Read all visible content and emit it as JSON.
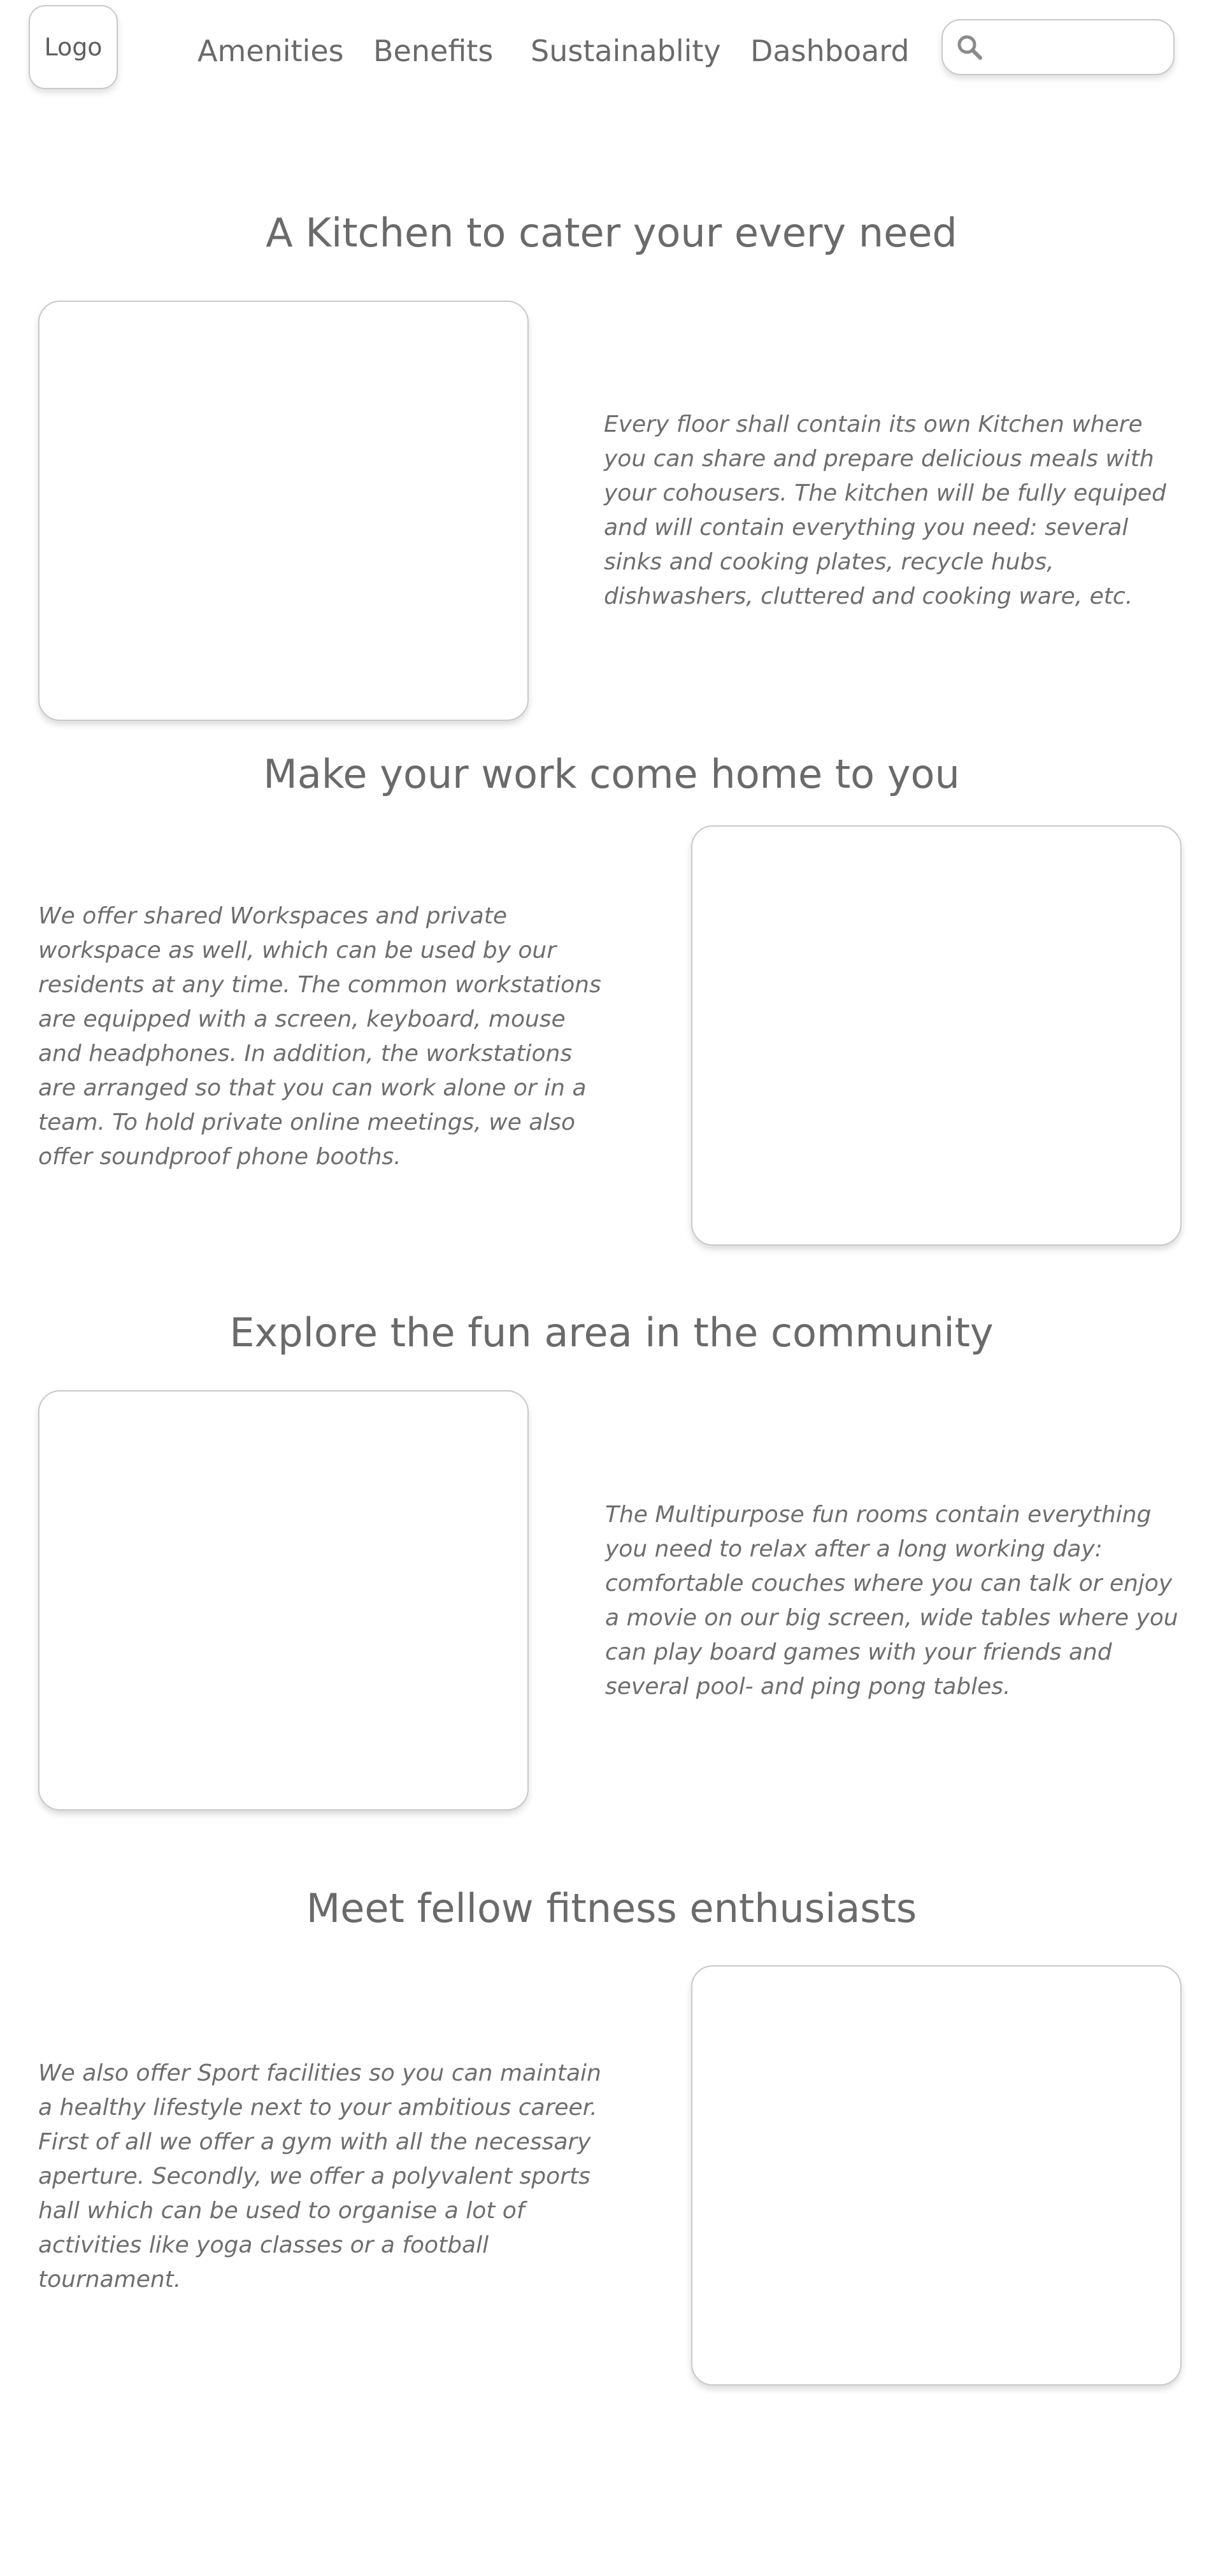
{
  "header": {
    "logo": "Logo",
    "nav": [
      "Amenities",
      "Benefits",
      "Sustainablity",
      "Dashboard"
    ],
    "search": {
      "icon": "search-icon",
      "value": "",
      "placeholder": ""
    }
  },
  "sections": [
    {
      "title": "A Kitchen to cater your every need",
      "text": "Every floor shall contain its own Kitchen where you can share and prepare delicious meals with your cohousers. The kitchen will be fully equiped and will contain everything you need: several sinks and cooking plates, recycle hubs, dishwashers, cluttered and cooking ware, etc."
    },
    {
      "title": "Make your work come home to you",
      "text": "We offer shared Workspaces and private workspace as well, which can be used by our residents at any time. The common workstations are equipped with a screen, keyboard, mouse and headphones. In addition, the workstations are arranged so that you can work alone or in a team. To hold private online meetings, we also offer soundproof phone booths."
    },
    {
      "title": "Explore the fun area in the community",
      "text": "The Multipurpose fun rooms contain everything you need to relax after a long working day: comfortable couches where you can talk or enjoy a movie on our big screen, wide tables where you can play board games with your friends and several pool- and ping pong tables."
    },
    {
      "title": "Meet fellow fitness enthusiasts",
      "text": "We also offer Sport facilities so you can maintain a healthy lifestyle next to your ambitious career. First of all we offer a gym with all the necessary aperture. Secondly, we offer a polyvalent sports hall which can be used to organise a lot of activities like yoga classes or a football tournament."
    }
  ]
}
